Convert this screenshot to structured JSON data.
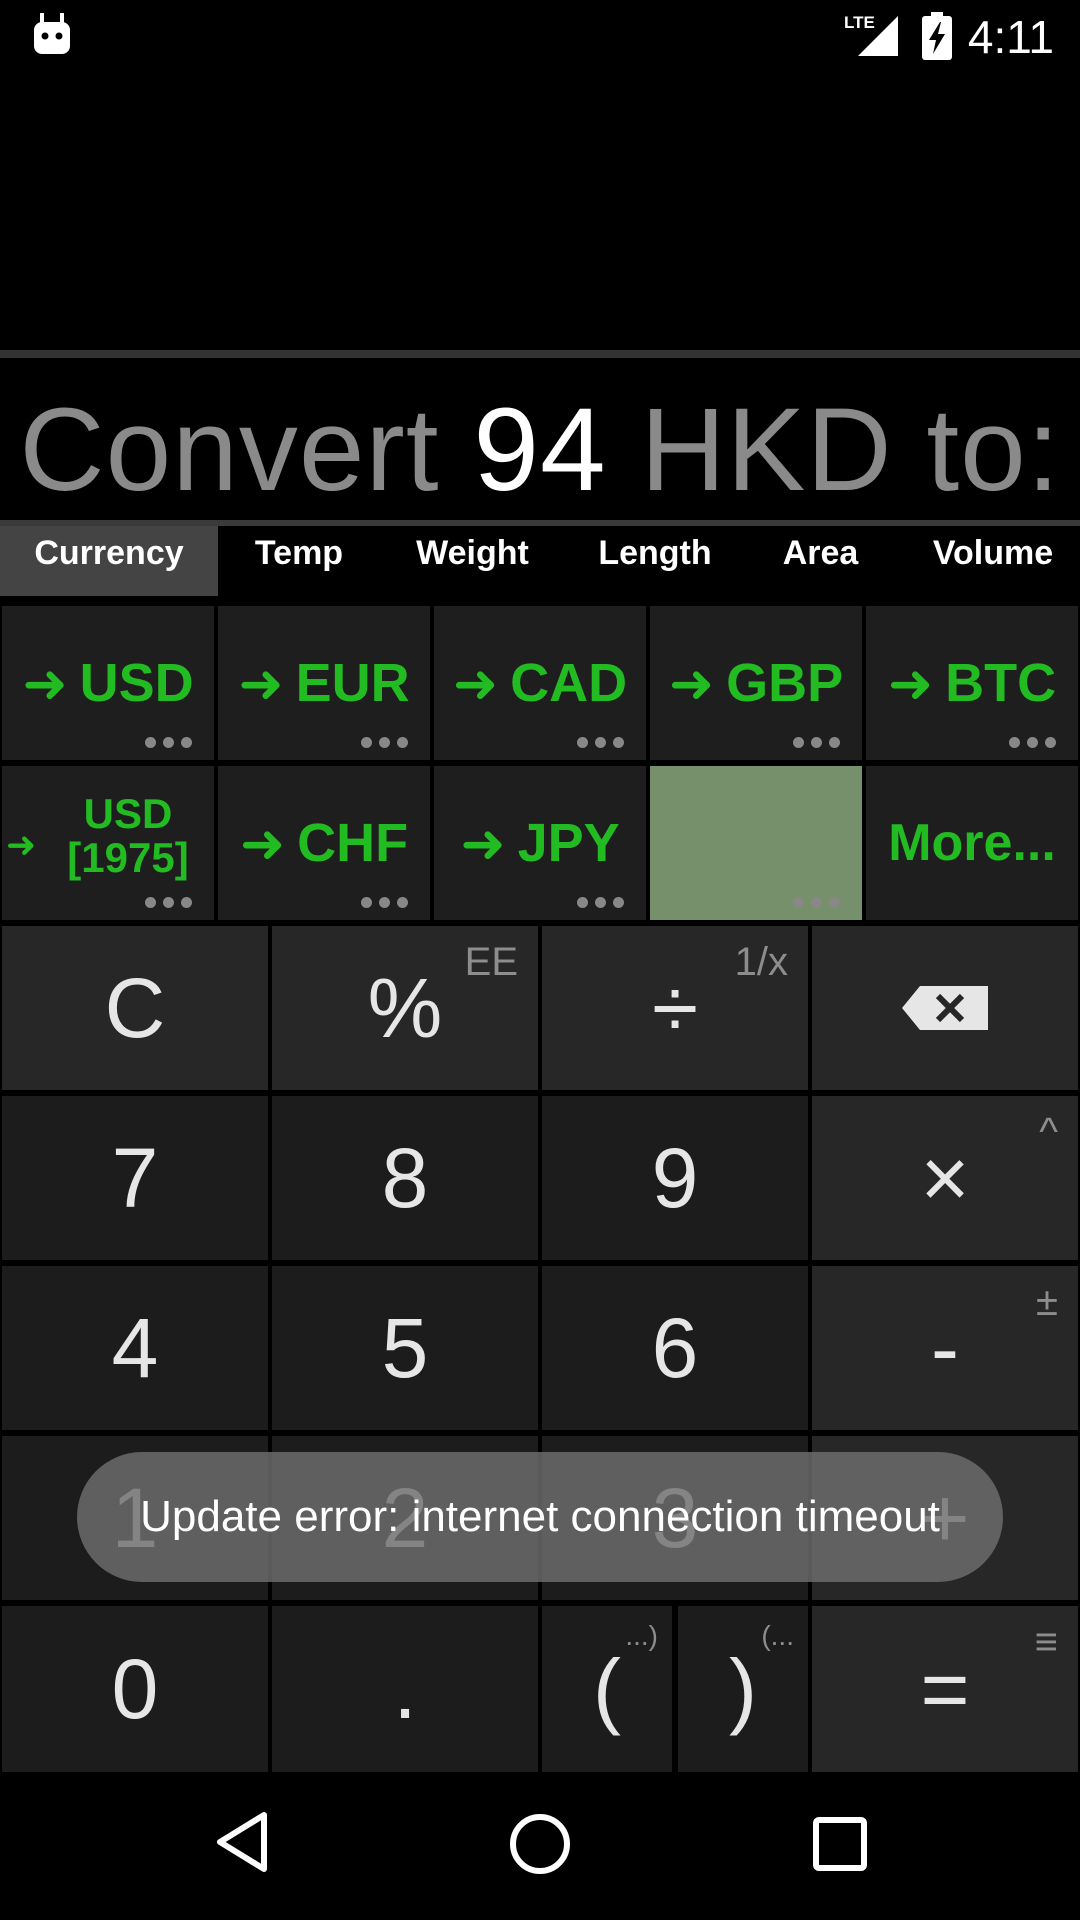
{
  "status_bar": {
    "time": "4:11",
    "network": "LTE"
  },
  "display": {
    "prefix": "Convert",
    "amount": "94",
    "currency": "HKD",
    "suffix": "to:"
  },
  "tabs": [
    "Currency",
    "Temp",
    "Weight",
    "Length",
    "Area",
    "Volume"
  ],
  "unit_buttons": {
    "usd": "USD",
    "eur": "EUR",
    "cad": "CAD",
    "gbp": "GBP",
    "btc": "BTC",
    "usd1975_line1": "USD",
    "usd1975_line2": "[1975]",
    "chf": "CHF",
    "jpy": "JPY",
    "more": "More..."
  },
  "keypad": {
    "clear": "C",
    "percent": "%",
    "percent_alt": "EE",
    "divide": "÷",
    "divide_alt": "1/x",
    "seven": "7",
    "eight": "8",
    "nine": "9",
    "multiply": "×",
    "multiply_alt": "^",
    "four": "4",
    "five": "5",
    "six": "6",
    "minus": "-",
    "minus_alt": "±",
    "one": "1",
    "two": "2",
    "three": "3",
    "plus": "+",
    "zero": "0",
    "dot": ".",
    "open_paren": "(",
    "open_paren_alt": "...)",
    "close_paren": ")",
    "close_paren_alt": "(...",
    "equals": "=",
    "equals_alt": "≡"
  },
  "toast": "Update error: internet connection timeout",
  "colors": {
    "accent_green": "#22bb22",
    "selected_unit": "#76906b"
  }
}
